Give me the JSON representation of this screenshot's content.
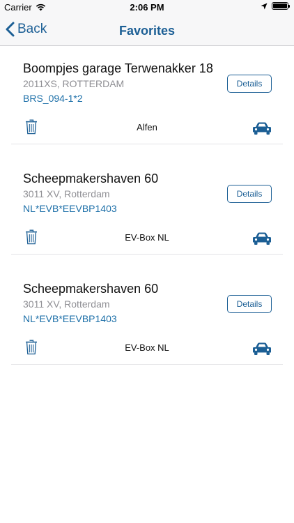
{
  "status_bar": {
    "carrier": "Carrier",
    "time": "2:06 PM",
    "battery_level": 1.0
  },
  "nav": {
    "back_label": "Back",
    "title": "Favorites"
  },
  "favorites": [
    {
      "title": "Boompjes garage Terwenakker 18",
      "address": "2011XS, ROTTERDAM",
      "code": "BRS_094-1*2",
      "details_label": "Details",
      "operator": "Alfen"
    },
    {
      "title": "Scheepmakershaven 60",
      "address": "3011 XV, Rotterdam",
      "code": "NL*EVB*EEVBP1403",
      "details_label": "Details",
      "operator": "EV-Box NL"
    },
    {
      "title": "Scheepmakershaven 60",
      "address": "3011 XV, Rotterdam",
      "code": "NL*EVB*EEVBP1403",
      "details_label": "Details",
      "operator": "EV-Box NL"
    }
  ],
  "colors": {
    "accent": "#1c5f95",
    "link": "#1c6fa8",
    "secondary_text": "#8e8e93"
  }
}
